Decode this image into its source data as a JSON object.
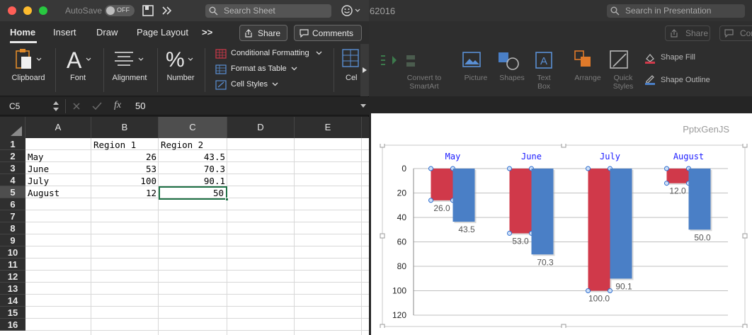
{
  "excel": {
    "autosave_label": "AutoSave",
    "autosave_state": "OFF",
    "search_placeholder": "Search Sheet",
    "tabs": [
      "Home",
      "Insert",
      "Draw",
      "Page Layout"
    ],
    "more_tabs": ">>",
    "share_label": "Share",
    "comments_label": "Comments",
    "ribbon": {
      "clipboard": "Clipboard",
      "font": "Font",
      "alignment": "Alignment",
      "number": "Number",
      "conditional_formatting": "Conditional Formatting",
      "format_as_table": "Format as Table",
      "cell_styles": "Cell Styles",
      "cells_truncated": "Cel"
    },
    "name_box": "C5",
    "fx": "fx",
    "formula_value": "50",
    "column_headers": [
      "A",
      "B",
      "C",
      "D",
      "E"
    ],
    "row_headers": [
      "1",
      "2",
      "3",
      "4",
      "5",
      "6",
      "7",
      "8",
      "9",
      "10",
      "11",
      "12",
      "13",
      "14",
      "15",
      "16"
    ],
    "cells": {
      "b1": "Region 1",
      "c1": "Region 2",
      "a2": "May",
      "b2": "26",
      "c2": "43.5",
      "a3": "June",
      "b3": "53",
      "c3": "70.3",
      "a4": "July",
      "b4": "100",
      "c4": "90.1",
      "a5": "August",
      "b5": "12",
      "c5": "50"
    }
  },
  "powerpoint": {
    "title_fragment": "62016",
    "search_placeholder": "Search in Presentation",
    "share_label": "Share",
    "comments_fragment": "Con",
    "ribbon": {
      "convert_to_smartart_1": "Convert to",
      "convert_to_smartart_2": "SmartArt",
      "picture": "Picture",
      "shapes": "Shapes",
      "text_box_1": "Text",
      "text_box_2": "Box",
      "arrange": "Arrange",
      "quick_styles_1": "Quick",
      "quick_styles_2": "Styles",
      "shape_fill": "Shape Fill",
      "shape_outline": "Shape Outline"
    },
    "slide_watermark": "PptxGenJS"
  },
  "chart_data": {
    "type": "bar",
    "orientation": "vertical, y-axis reversed (bars hang down from 0)",
    "categories": [
      "May",
      "June",
      "July",
      "August"
    ],
    "series": [
      {
        "name": "Region 1",
        "values": [
          26,
          53,
          100,
          12
        ],
        "color": "#d0394a"
      },
      {
        "name": "Region 2",
        "values": [
          43.5,
          70.3,
          90.1,
          50
        ],
        "color": "#4a7fc6"
      }
    ],
    "data_labels": [
      [
        "26.0",
        "53.0",
        "100.0",
        "12.0"
      ],
      [
        "43.5",
        "70.3",
        "90.1",
        "50.0"
      ]
    ],
    "y_ticks": [
      "0",
      "20",
      "40",
      "60",
      "80",
      "100",
      "120"
    ],
    "ylim": [
      0,
      120
    ],
    "category_axis_position": "top",
    "category_label_color": "#1a1aff",
    "grid": true,
    "legend": "none"
  },
  "colors": {
    "excel_accent": "#1d6f42",
    "selected_cell_border": "#1e7145"
  }
}
